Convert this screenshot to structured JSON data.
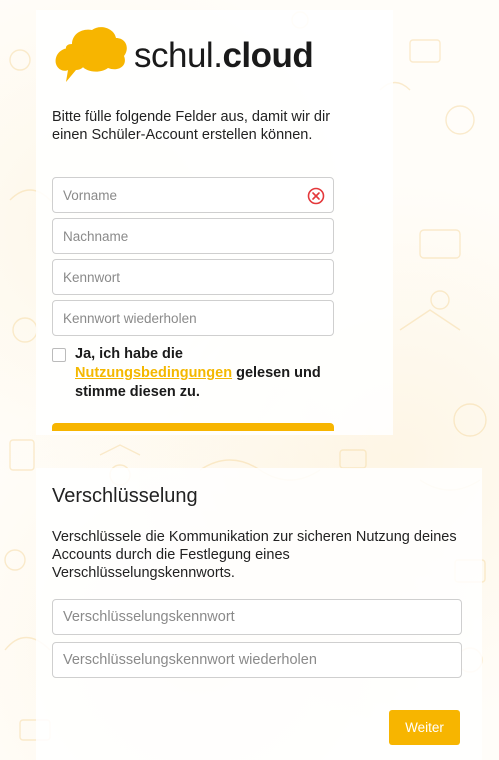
{
  "brand": {
    "name_light": "schul.",
    "name_bold": "cloud",
    "color": "#f7b500"
  },
  "registration": {
    "intro": "Bitte fülle folgende Felder aus, damit wir dir einen Schüler-Account erstellen können.",
    "first_name": {
      "placeholder": "Vorname",
      "value": "",
      "error_icon": "error-circle-icon"
    },
    "last_name": {
      "placeholder": "Nachname",
      "value": ""
    },
    "password": {
      "placeholder": "Kennwort",
      "value": ""
    },
    "password_repeat": {
      "placeholder": "Kennwort wiederholen",
      "value": ""
    },
    "terms": {
      "prefix": "Ja, ich habe die",
      "link": "Nutzungsbedingungen",
      "suffix": "gelesen und stimme diesen zu.",
      "checked": false
    }
  },
  "encryption": {
    "title": "Verschlüsselung",
    "description": "Verschlüssele die Kommunikation zur sicheren Nutzung deines Accounts durch die Festlegung eines Verschlüsselungskennworts.",
    "key": {
      "placeholder": "Verschlüsselungskennwort",
      "value": ""
    },
    "key_repeat": {
      "placeholder": "Verschlüsselungskennwort wiederholen",
      "value": ""
    }
  },
  "actions": {
    "next_label": "Weiter"
  }
}
